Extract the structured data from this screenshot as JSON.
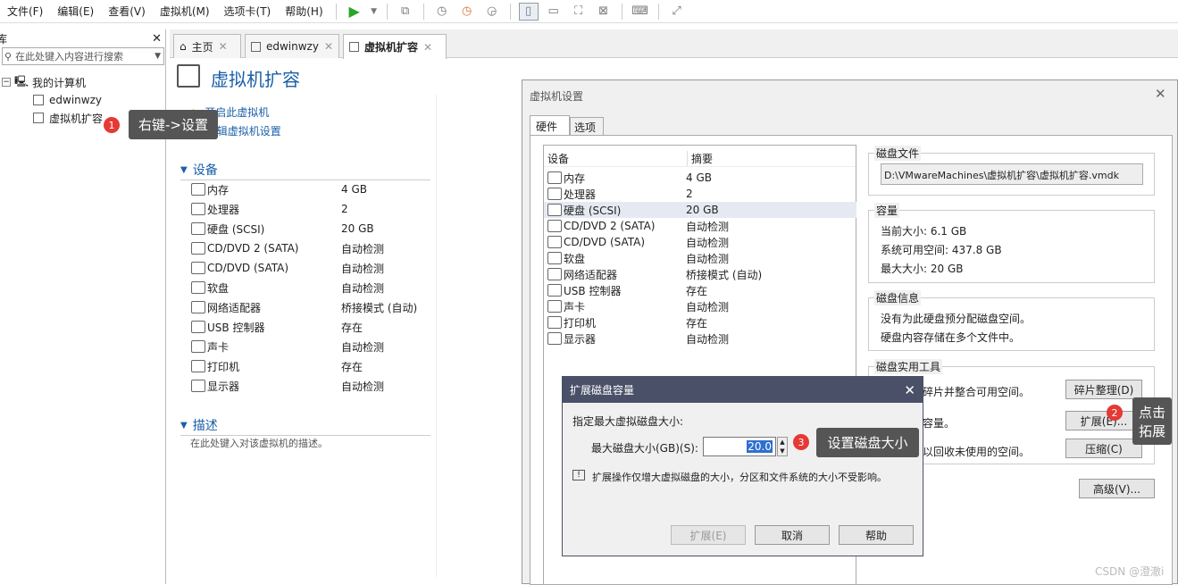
{
  "menu": {
    "items": [
      "文件(F)",
      "编辑(E)",
      "查看(V)",
      "虚拟机(M)",
      "选项卡(T)",
      "帮助(H)"
    ]
  },
  "library": {
    "header": "库",
    "search_placeholder": "在此处键入内容进行搜索",
    "root": "我的计算机",
    "vm1": "edwinwzy",
    "vm2": "虚拟机扩容"
  },
  "tabs": {
    "home": "主页",
    "tab1": "edwinwzy",
    "tab2": "虚拟机扩容"
  },
  "vm": {
    "title": "虚拟机扩容",
    "power_on": "开启此虚拟机",
    "edit": "编辑虚拟机设置",
    "devices_title": "设备",
    "desc_title": "描述",
    "desc_placeholder": "在此处键入对该虚拟机的描述。"
  },
  "devices": [
    {
      "name": "内存",
      "value": "4 GB",
      "icon": "memory-icon"
    },
    {
      "name": "处理器",
      "value": "2",
      "icon": "cpu-icon"
    },
    {
      "name": "硬盘 (SCSI)",
      "value": "20 GB",
      "icon": "harddisk-icon"
    },
    {
      "name": "CD/DVD 2 (SATA)",
      "value": "自动检测",
      "icon": "cd-icon"
    },
    {
      "name": "CD/DVD (SATA)",
      "value": "自动检测",
      "icon": "cd-icon"
    },
    {
      "name": "软盘",
      "value": "自动检测",
      "icon": "floppy-icon"
    },
    {
      "name": "网络适配器",
      "value": "桥接模式 (自动)",
      "icon": "network-icon"
    },
    {
      "name": "USB 控制器",
      "value": "存在",
      "icon": "usb-icon"
    },
    {
      "name": "声卡",
      "value": "自动检测",
      "icon": "sound-icon"
    },
    {
      "name": "打印机",
      "value": "存在",
      "icon": "printer-icon"
    },
    {
      "name": "显示器",
      "value": "自动检测",
      "icon": "monitor-icon"
    }
  ],
  "settings": {
    "title": "虚拟机设置",
    "tab_hardware": "硬件",
    "tab_options": "选项",
    "col_device": "设备",
    "col_summary": "摘要",
    "disk_file_title": "磁盘文件",
    "disk_file": "D:\\VMwareMachines\\虚拟机扩容\\虚拟机扩容.vmdk",
    "capacity_title": "容量",
    "current": "当前大小: 6.1 GB",
    "available": "系统可用空间: 437.8 GB",
    "max": "最大大小: 20 GB",
    "info_title": "磁盘信息",
    "info1": "没有为此硬盘预分配磁盘空间。",
    "info2": "硬盘内容存储在多个文件中。",
    "util_title": "磁盘实用工具",
    "util1": "碎片并整合可用空间。",
    "util2": "容量。",
    "util3": "以回收未使用的空间。",
    "btn_defrag": "碎片整理(D)",
    "btn_expand": "扩展(E)...",
    "btn_compact": "压缩(C)",
    "btn_advanced": "高级(V)..."
  },
  "expand": {
    "title": "扩展磁盘容量",
    "label": "指定最大虚拟磁盘大小:",
    "field_label": "最大磁盘大小(GB)(S):",
    "value": "20.0",
    "note": "扩展操作仅增大虚拟磁盘的大小，分区和文件系统的大小不受影响。",
    "btn_expand": "扩展(E)",
    "btn_cancel": "取消",
    "btn_help": "帮助"
  },
  "callouts": {
    "c1": "右键->设置",
    "c2a": "点击",
    "c2b": "拓展",
    "c3": "设置磁盘大小",
    "n1": "1",
    "n2": "2",
    "n3": "3"
  },
  "watermark": "CSDN @澄澈i"
}
